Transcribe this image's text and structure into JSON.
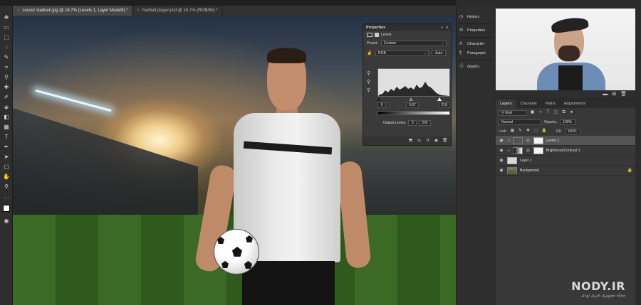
{
  "tabs": [
    {
      "label": "soccer stadium.jpg @ 16.7% (Levels 1, Layer Mask/8) *",
      "active": true
    },
    {
      "label": "football player.psd @ 16.7% (RGB/8#) *",
      "active": false
    }
  ],
  "properties": {
    "title": "Properties",
    "adjustment": "Levels",
    "preset_label": "Preset:",
    "preset_value": "Custom",
    "channel": "RGB",
    "auto_label": "Auto",
    "input_black": "0",
    "input_gamma": "0.87",
    "input_white": "218",
    "output_label": "Output Levels:",
    "output_black": "0",
    "output_white": "255"
  },
  "dock": [
    {
      "label": "History",
      "icon": "history-icon"
    },
    {
      "label": "Properties",
      "icon": "properties-icon"
    },
    {
      "label": "Character",
      "icon": "character-icon"
    },
    {
      "label": "Paragraph",
      "icon": "paragraph-icon"
    },
    {
      "label": "Glyphs",
      "icon": "glyphs-icon"
    }
  ],
  "layers_panel": {
    "tabs": [
      "Layers",
      "Channels",
      "Paths",
      "Adjustments"
    ],
    "filter": "Kind",
    "blend_mode": "Normal",
    "opacity_label": "Opacity:",
    "opacity": "100%",
    "lock_label": "Lock:",
    "fill_label": "Fill:",
    "fill": "100%",
    "layers": [
      {
        "name": "Levels 1",
        "selected": true,
        "adjustment": true
      },
      {
        "name": "Brightness/Contrast 1",
        "selected": false,
        "adjustment": true
      },
      {
        "name": "Layer 1",
        "selected": false,
        "adjustment": false
      },
      {
        "name": "Background",
        "selected": false,
        "adjustment": false,
        "locked": true
      }
    ]
  },
  "watermark": {
    "main": "NODY.IR",
    "sub": "مجله تصویری غیری نودی"
  }
}
